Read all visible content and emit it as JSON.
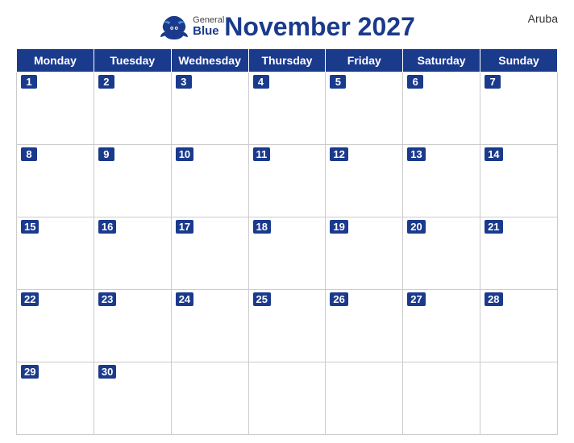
{
  "header": {
    "title": "November 2027",
    "country": "Aruba",
    "logo": {
      "general": "General",
      "blue": "Blue"
    }
  },
  "calendar": {
    "weekdays": [
      "Monday",
      "Tuesday",
      "Wednesday",
      "Thursday",
      "Friday",
      "Saturday",
      "Sunday"
    ],
    "weeks": [
      [
        1,
        2,
        3,
        4,
        5,
        6,
        7
      ],
      [
        8,
        9,
        10,
        11,
        12,
        13,
        14
      ],
      [
        15,
        16,
        17,
        18,
        19,
        20,
        21
      ],
      [
        22,
        23,
        24,
        25,
        26,
        27,
        28
      ],
      [
        29,
        30,
        null,
        null,
        null,
        null,
        null
      ]
    ]
  }
}
